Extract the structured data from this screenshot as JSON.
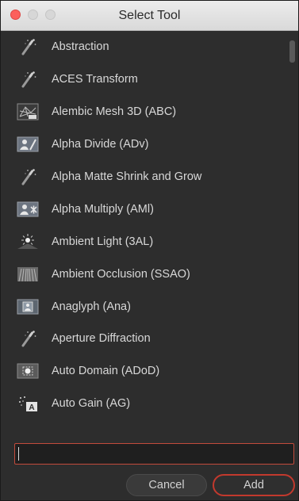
{
  "window": {
    "title": "Select Tool"
  },
  "tools": [
    {
      "label": "Abstraction",
      "icon": "magic-wand-icon"
    },
    {
      "label": "ACES Transform",
      "icon": "magic-wand-icon"
    },
    {
      "label": "Alembic Mesh 3D (ABC)",
      "icon": "mesh-3d-icon"
    },
    {
      "label": "Alpha Divide (ADv)",
      "icon": "alpha-divide-icon"
    },
    {
      "label": "Alpha Matte Shrink and Grow",
      "icon": "magic-wand-icon"
    },
    {
      "label": "Alpha Multiply (AMl)",
      "icon": "alpha-multiply-icon"
    },
    {
      "label": "Ambient Light (3AL)",
      "icon": "ambient-light-icon"
    },
    {
      "label": "Ambient Occlusion (SSAO)",
      "icon": "ambient-occlusion-icon"
    },
    {
      "label": "Anaglyph (Ana)",
      "icon": "anaglyph-icon"
    },
    {
      "label": "Aperture Diffraction",
      "icon": "magic-wand-icon"
    },
    {
      "label": "Auto Domain (ADoD)",
      "icon": "auto-domain-icon"
    },
    {
      "label": "Auto Gain (AG)",
      "icon": "auto-gain-icon"
    }
  ],
  "search": {
    "value": "",
    "placeholder": ""
  },
  "buttons": {
    "cancel": "Cancel",
    "add": "Add"
  },
  "colors": {
    "accent": "#c2392d",
    "background": "#2d2d2d",
    "text": "#d8d8d8"
  }
}
